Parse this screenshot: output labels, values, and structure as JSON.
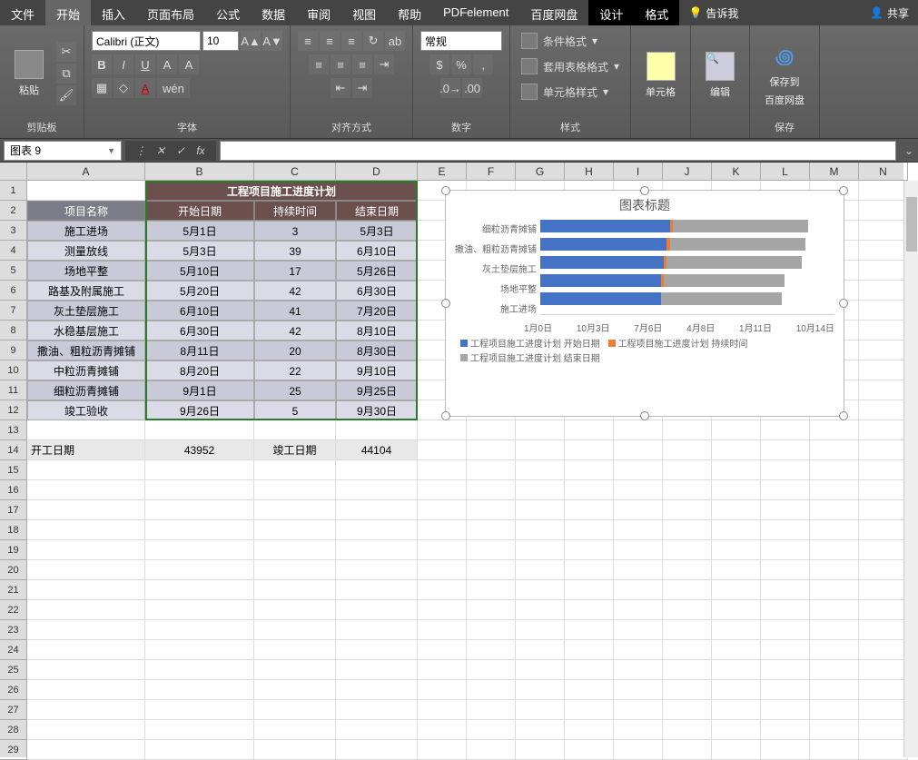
{
  "tabs": {
    "file": "文件",
    "home": "开始",
    "insert": "插入",
    "layout": "页面布局",
    "formula": "公式",
    "data": "数据",
    "review": "审阅",
    "view": "视图",
    "help": "帮助",
    "pdf": "PDFelement",
    "baidu": "百度网盘",
    "design": "设计",
    "format": "格式",
    "tellme": "告诉我",
    "share": "共享"
  },
  "ribbon": {
    "paste": "粘贴",
    "clipboard": "剪贴板",
    "font_name": "Calibri (正文)",
    "font_size": "10",
    "font_group": "字体",
    "align_group": "对齐方式",
    "number_format": "常规",
    "number_group": "数字",
    "cond_fmt": "条件格式",
    "table_fmt": "套用表格格式",
    "cell_style": "单元格样式",
    "style_group": "样式",
    "cells": "单元格",
    "editing": "编辑",
    "save_baidu1": "保存到",
    "save_baidu2": "百度网盘",
    "save_group": "保存"
  },
  "namebox": "图表 9",
  "colWidths": {
    "A": 130,
    "B": 120,
    "C": 90,
    "D": 90,
    "rest": 54
  },
  "table": {
    "title": "工程项目施工进度计划",
    "h0": "项目名称",
    "h1": "开始日期",
    "h2": "持续时间",
    "h3": "结束日期",
    "rows": [
      {
        "a": "施工进场",
        "b": "5月1日",
        "c": "3",
        "d": "5月3日"
      },
      {
        "a": "测量放线",
        "b": "5月3日",
        "c": "39",
        "d": "6月10日"
      },
      {
        "a": "场地平整",
        "b": "5月10日",
        "c": "17",
        "d": "5月26日"
      },
      {
        "a": "路基及附属施工",
        "b": "5月20日",
        "c": "42",
        "d": "6月30日"
      },
      {
        "a": "灰土垫层施工",
        "b": "6月10日",
        "c": "41",
        "d": "7月20日"
      },
      {
        "a": "水稳基层施工",
        "b": "6月30日",
        "c": "42",
        "d": "8月10日"
      },
      {
        "a": "撒油、粗粒沥青摊铺",
        "b": "8月11日",
        "c": "20",
        "d": "8月30日"
      },
      {
        "a": "中粒沥青摊铺",
        "b": "8月20日",
        "c": "22",
        "d": "9月10日"
      },
      {
        "a": "细粒沥青摊铺",
        "b": "9月1日",
        "c": "25",
        "d": "9月25日"
      },
      {
        "a": "竣工验收",
        "b": "9月26日",
        "c": "5",
        "d": "9月30日"
      }
    ]
  },
  "extra": {
    "a14": "开工日期",
    "b14": "43952",
    "c14": "竣工日期",
    "d14": "44104"
  },
  "chart": {
    "title": "图表标题",
    "ylabels": [
      "细粒沥青摊铺",
      "撒油、粗粒沥青摊铺",
      "灰土垫层施工",
      "场地平整",
      "施工进场"
    ],
    "xlabels": [
      "1月0日",
      "10月3日",
      "7月6日",
      "4月8日",
      "1月11日",
      "10月14日"
    ],
    "legend1": "工程项目施工进度计划 开始日期",
    "legend2": "工程项目施工进度计划 持续时间",
    "legend3": "工程项目施工进度计划 结束日期"
  },
  "chart_data": {
    "type": "bar",
    "title": "图表标题",
    "orientation": "horizontal",
    "categories": [
      "细粒沥青摊铺",
      "撒油、粗粒沥青摊铺",
      "灰土垫层施工",
      "场地平整",
      "施工进场"
    ],
    "series": [
      {
        "name": "工程项目施工进度计划 开始日期",
        "color": "#4472C4",
        "values": [
          44075,
          44054,
          44022,
          43961,
          43952
        ]
      },
      {
        "name": "工程项目施工进度计划 持续时间",
        "color": "#ED7D31",
        "values": [
          25,
          20,
          41,
          17,
          3
        ]
      },
      {
        "name": "工程项目施工进度计划 结束日期",
        "color": "#A5A5A5",
        "values": [
          44099,
          44073,
          44032,
          43977,
          43954
        ]
      }
    ],
    "xlabel": "",
    "ylabel": "",
    "x_ticks": [
      "1月0日",
      "10月3日",
      "7月6日",
      "4月8日",
      "1月11日",
      "10月14日"
    ]
  }
}
